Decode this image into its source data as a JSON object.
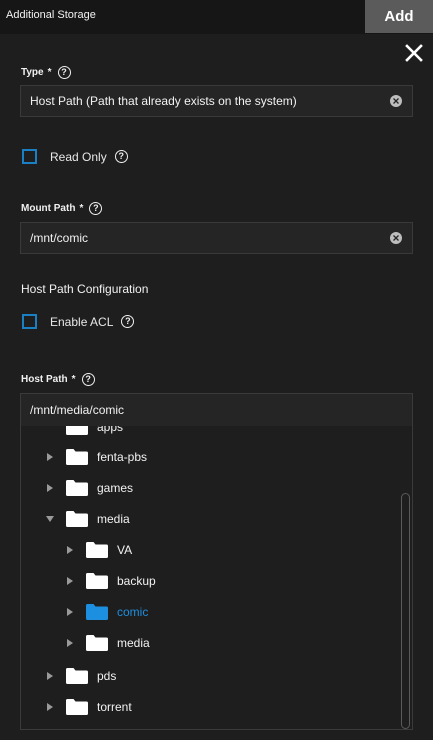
{
  "header": {
    "title": "Additional Storage",
    "add_label": "Add"
  },
  "type_field": {
    "label": "Type",
    "required": "*",
    "value": "Host Path (Path that already exists on the system)"
  },
  "read_only": {
    "label": "Read Only"
  },
  "mount_path": {
    "label": "Mount Path",
    "required": "*",
    "value": "/mnt/comic"
  },
  "host_path_config": {
    "title": "Host Path Configuration",
    "enable_acl_label": "Enable ACL"
  },
  "host_path": {
    "label": "Host Path",
    "required": "*",
    "value": "/mnt/media/comic"
  },
  "tree": {
    "partial_top": "apps",
    "items": [
      {
        "label": "fenta-pbs",
        "expanded": false,
        "selected": false
      },
      {
        "label": "games",
        "expanded": false,
        "selected": false
      },
      {
        "label": "media",
        "expanded": true,
        "selected": false
      },
      {
        "label": "VA",
        "expanded": false,
        "selected": false
      },
      {
        "label": "backup",
        "expanded": false,
        "selected": false
      },
      {
        "label": "comic",
        "expanded": false,
        "selected": true
      },
      {
        "label": "media",
        "expanded": false,
        "selected": false
      },
      {
        "label": "pds",
        "expanded": false,
        "selected": false
      },
      {
        "label": "torrent",
        "expanded": false,
        "selected": false
      }
    ]
  },
  "colors": {
    "accent": "#1d8fe0",
    "checkbox_border": "#1b7fc4",
    "add_button_bg": "#5b5b5b",
    "background": "#1e1e1e"
  },
  "icons": {
    "close": "close-icon",
    "help": "help-icon",
    "clear": "clear-icon",
    "folder": "folder-icon",
    "expand": "chevron-right-icon",
    "collapse": "chevron-down-icon"
  }
}
